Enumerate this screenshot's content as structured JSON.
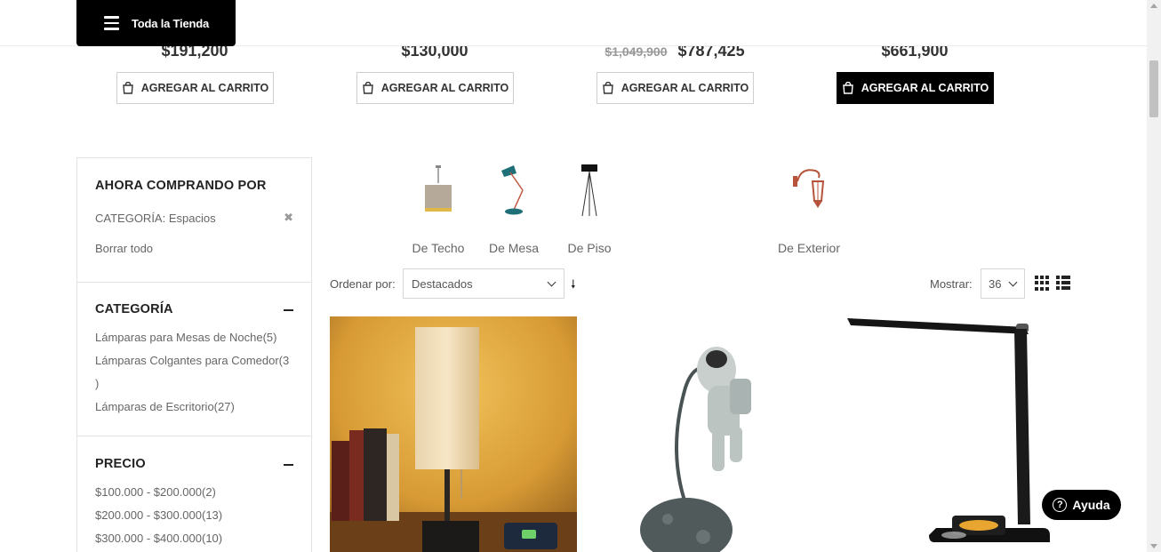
{
  "header": {
    "store_button_label": "Toda la Tienda"
  },
  "price_row": [
    {
      "old_price": "",
      "price": "$191,200",
      "button_label": "AGREGAR AL CARRITO"
    },
    {
      "old_price": "",
      "price": "$130,000",
      "button_label": "AGREGAR AL CARRITO"
    },
    {
      "old_price": "$1,049,900",
      "price": "$787,425",
      "button_label": "AGREGAR AL CARRITO"
    },
    {
      "old_price": "",
      "price": "$661,900",
      "button_label": "AGREGAR AL CARRITO"
    }
  ],
  "sidebar": {
    "now_shopping": {
      "title": "AHORA COMPRANDO POR",
      "filter_label": "CATEGORÍA: Espacios",
      "clear_all": "Borrar todo"
    },
    "category": {
      "title": "CATEGORÍA",
      "items": [
        "Lámparas para Mesas de Noche(5)",
        "Lámparas Colgantes para Comedor(3",
        ")",
        "Lámparas de Escritorio(27)"
      ]
    },
    "price": {
      "title": "PRECIO",
      "items": [
        "$100.000 - $200.000(2)",
        "$200.000 - $300.000(13)",
        "$300.000 - $400.000(10)"
      ]
    }
  },
  "categories": [
    {
      "label": "De Techo",
      "icon": "pendant-lamp-icon"
    },
    {
      "label": "De Mesa",
      "icon": "desk-lamp-icon"
    },
    {
      "label": "De Piso",
      "icon": "floor-lamp-icon"
    },
    {
      "label": "De Exterior",
      "icon": "wall-lantern-icon"
    }
  ],
  "toolbar": {
    "order_label": "Ordenar por:",
    "order_value": "Destacados",
    "show_label": "Mostrar:",
    "show_value": "36"
  },
  "help": {
    "label": "Ayuda"
  },
  "colors": {
    "accent": "#000000",
    "text": "#333333",
    "muted": "#666666"
  }
}
